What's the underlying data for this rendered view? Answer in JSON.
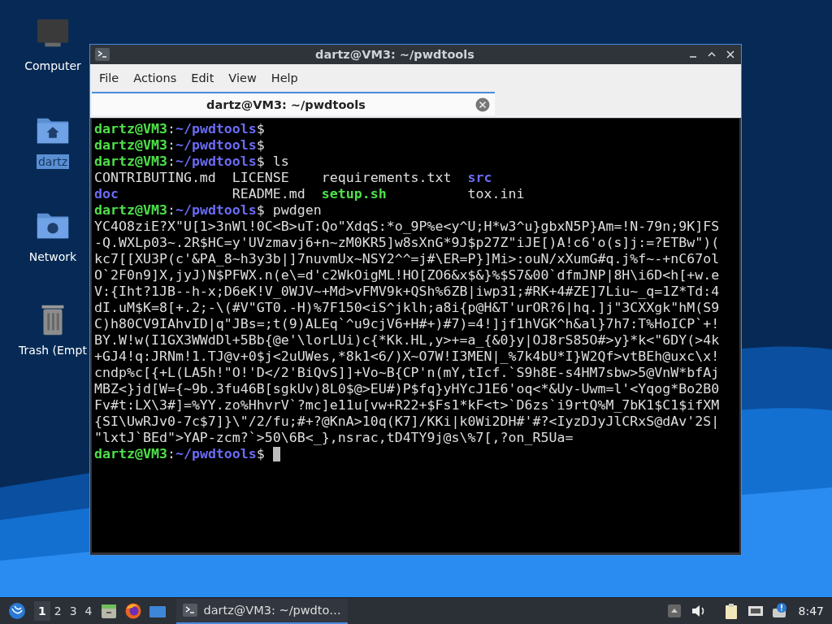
{
  "desktop": {
    "icons": [
      {
        "label": "Computer",
        "kind": "computer",
        "selected": false
      },
      {
        "label": "dartz",
        "kind": "home",
        "selected": true
      },
      {
        "label": "Network",
        "kind": "network",
        "selected": false
      },
      {
        "label": "Trash (Empt",
        "kind": "trash",
        "selected": false
      }
    ]
  },
  "window": {
    "title": "dartz@VM3: ~/pwdtools",
    "menu": [
      "File",
      "Actions",
      "Edit",
      "View",
      "Help"
    ],
    "tabs": [
      {
        "label": "dartz@VM3: ~/pwdtools",
        "selected": true
      }
    ],
    "terminal": {
      "lines": [
        {
          "kind": "prompt",
          "host": "dartz@VM3",
          "sep": ":",
          "path": "~/pwdtools",
          "symbol": "$"
        },
        {
          "kind": "prompt",
          "host": "dartz@VM3",
          "sep": ":",
          "path": "~/pwdtools",
          "symbol": "$"
        },
        {
          "kind": "prompt",
          "host": "dartz@VM3",
          "sep": ":",
          "path": "~/pwdtools",
          "symbol": "$",
          "command": "ls"
        },
        {
          "kind": "listing",
          "entries": [
            {
              "name": "CONTRIBUTING.md",
              "kind": "file"
            },
            {
              "name": "LICENSE",
              "kind": "file"
            },
            {
              "name": "requirements.txt",
              "kind": "file"
            },
            {
              "name": "src",
              "kind": "dir"
            }
          ]
        },
        {
          "kind": "listing",
          "entries": [
            {
              "name": "doc",
              "kind": "dir"
            },
            {
              "name": "README.md",
              "kind": "file"
            },
            {
              "name": "setup.sh",
              "kind": "exec"
            },
            {
              "name": "tox.ini",
              "kind": "file"
            }
          ]
        },
        {
          "kind": "prompt",
          "host": "dartz@VM3",
          "sep": ":",
          "path": "~/pwdtools",
          "symbol": "$",
          "command": "pwdgen"
        },
        {
          "kind": "output",
          "text": "YC4O8ziE?X\"U[1>3nWl!0C<B>uT:Qo\"XdqS:*o_9P%e<y^U;H*w3^u}gbxN5P}Am=!N-79n;9K]FS"
        },
        {
          "kind": "output",
          "text": "-Q.WXLp03~.2R$HC=y'UVzmavj6+n~zM0KR5]w8sXnG*9J$p27Z\"iJE[)A!c6'o(s]j:=?ETBw\")("
        },
        {
          "kind": "output",
          "text": "kc7[[XU3P(c'&PA_8~h3y3b|]7nuvmUx~NSY2^^=j#\\ER=P}]Mi>:ouN/xXumG#q.j%f~-+nC67ol"
        },
        {
          "kind": "output",
          "text": "O`2F0n9]X,jyJ)N$PFWX.n(e\\=d'c2WkOigML!HO[ZO6&x$&}%$S7&00`dfmJNP|8H\\i6D<h[+w.e"
        },
        {
          "kind": "output",
          "text": "V:{Iht?1JB--h-x;D6eK!V_0WJV~+Md>vFMV9k+QSh%6ZB|iwp31;#RK+4#ZE]7Liu~_q=1Z*Td:4"
        },
        {
          "kind": "output",
          "text": "dI.uM$K=8[+.2;-\\(#V\"GT0.-H)%7F150<iS^jklh;a8i{p@H&T'urOR?6|hq.]j\"3CXXgk\"hM(S9"
        },
        {
          "kind": "output",
          "text": "C)h80CV9IAhvID|q\"JBs=;t(9)ALEq`^u9cjV6+H#+)#7)=4!]jf1hVGK^h&al}7h7:T%HoICP`+!"
        },
        {
          "kind": "output",
          "text": "BY.W!w(I1GX3WWdDl+5Bb{@e'\\lorLUi)c{*Kk.HL,y>+=a_{&0}y|OJ8rS85O#>y}*k<\"6DY(>4k"
        },
        {
          "kind": "output",
          "text": "+GJ4!q:JRNm!1.TJ@v+0$j<2uUWes,*8k1<6/)X~O7W!I3MEN|_%7k4bU*I}W2Qf>vtBEh@uxc\\x!"
        },
        {
          "kind": "output",
          "text": "cndp%c[{+L(LA5h!\"O!'D</2'BiQvS]]+Vo~B{CP'n(mY,tIcf.`S9h8E-s4HM7sbw>5@VnW*bfAj"
        },
        {
          "kind": "output",
          "text": "MBZ<}jd[W={~9b.3fu46B[sgkUv)8L0$@>EU#)P$fq}yHYcJ1E6'oq<*&Uy-Uwm=l'<Yqog*Bo2B0"
        },
        {
          "kind": "output",
          "text": "Fv#t:LX\\3#]=%YY.zo%HhvrV`?mc]e11u[vw+R22+$Fs1*kF<t>`D6zs`i9rtQ%M_7bK1$C1$ifXM"
        },
        {
          "kind": "output",
          "text": "{SI\\UwRJv0-7c$7]}\\\"/2/fu;#+?@KnA>10q(K7]/KKi|k0Wi2DH#'#?<IyzDJyJlCRxS@dAv'2S|"
        },
        {
          "kind": "output",
          "text": "\"lxtJ`BEd\">YAP-zcm?`>50\\6B<_},nsrac,tD4TY9j@s\\%7[,?on_R5Ua="
        },
        {
          "kind": "prompt",
          "host": "dartz@VM3",
          "sep": ":",
          "path": "~/pwdtools",
          "symbol": "$",
          "cursor": true
        }
      ]
    }
  },
  "taskbar": {
    "workspaces": [
      {
        "label": "1",
        "selected": true
      },
      {
        "label": "2",
        "selected": false
      },
      {
        "label": "3",
        "selected": false
      },
      {
        "label": "4",
        "selected": false
      }
    ],
    "tasks": [
      {
        "label": "dartz@VM3: ~/pwdto…",
        "selected": true
      }
    ],
    "clock": "8:47"
  }
}
